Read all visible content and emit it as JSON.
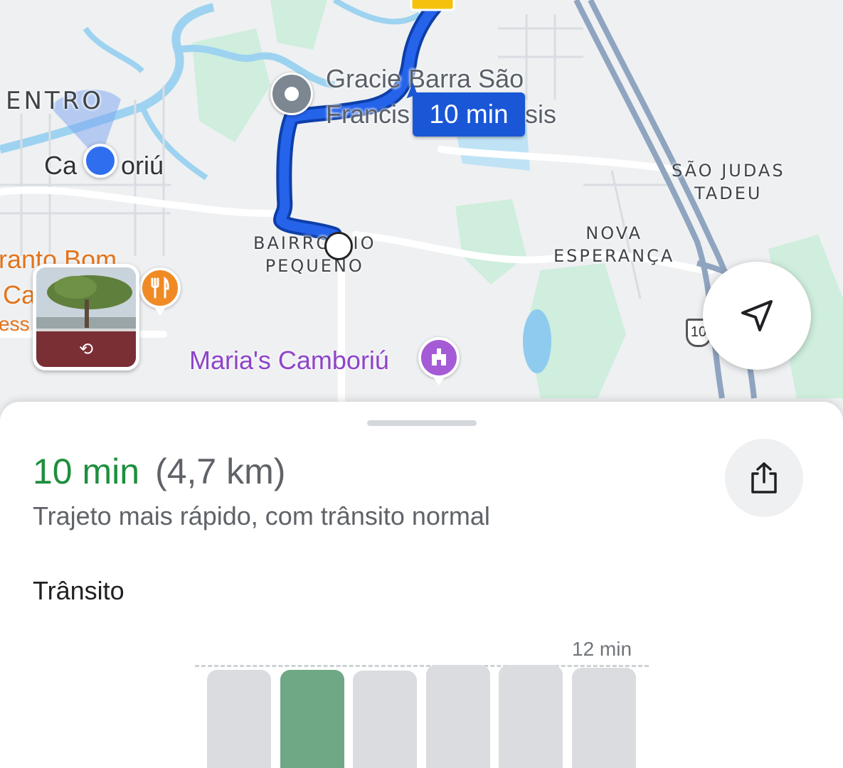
{
  "map": {
    "labels": {
      "centro": "ENTRO",
      "camboriu_left": "Ca",
      "camboriu_right": "oriú",
      "gracie_line1": "Gracie Barra São",
      "gracie_line2": "Francis",
      "gracie_line2_tail": "sis",
      "bairro_rio_pequeno_line1": "BAIRRO RIO",
      "bairro_rio_pequeno_line2": "PEQUENO",
      "sao_judas_line1": "SÃO JUDAS",
      "sao_judas_line2": "TADEU",
      "nova_esperanca_line1": "NOVA",
      "nova_esperanca_line2": "ESPERANÇA",
      "marias_camboriu": "Maria's Camboriú",
      "restaurant_line1": "ranto Bom",
      "restaurant_line2": "Ca",
      "restaurant_line3": "ess",
      "highway_shield": "10"
    },
    "route_badge": "10 min",
    "icons": {
      "start": "start-point-icon",
      "destination": "destination-icon",
      "current_location": "current-location-dot",
      "restaurant": "fork-knife-icon",
      "attraction": "attraction-icon",
      "locate": "navigation-arrow-icon",
      "street_view": "street-view-rotate-icon"
    },
    "colors": {
      "route": "#1a57d6",
      "water": "#9dd3f0",
      "park": "#c9ebd9",
      "road": "#ffffff"
    }
  },
  "sheet": {
    "duration": "10 min",
    "distance": "(4,7 km)",
    "subtitle": "Trajeto mais rápido, com trânsito normal",
    "traffic_title": "Trânsito",
    "share_icon": "share-icon"
  },
  "chart_data": {
    "type": "bar",
    "max_label": "12 min",
    "max_value": 12,
    "bars": [
      {
        "value": 11.4,
        "active": false
      },
      {
        "value": 11.4,
        "active": true
      },
      {
        "value": 11.3,
        "active": false
      },
      {
        "value": 12.0,
        "active": false
      },
      {
        "value": 12.0,
        "active": false
      },
      {
        "value": 11.7,
        "active": false
      }
    ],
    "colors": {
      "active": "#6fa884",
      "inactive": "#dadce0"
    }
  }
}
